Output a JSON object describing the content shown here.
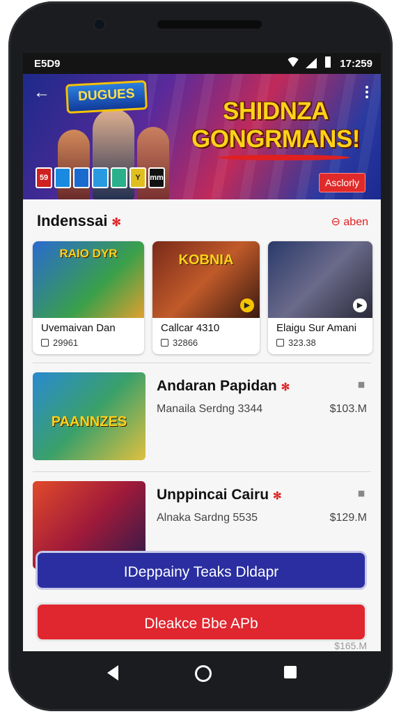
{
  "status_bar": {
    "left": "E5D9",
    "time": "17:259"
  },
  "banner": {
    "logo": "DUGUES",
    "headline_line1": "SHIDNZA",
    "headline_line2": "GONGRMANS!",
    "action_badge": "Asclorly",
    "mini_icons": [
      "59",
      "",
      "",
      "",
      "",
      "Y",
      "mm"
    ]
  },
  "section": {
    "title": "Indenssai",
    "link": "⊖ aben"
  },
  "cards": [
    {
      "thumb_text": "RAIO DYR",
      "title": "Uvemaivan Dan",
      "meta": "29961"
    },
    {
      "thumb_text": "KOBNIA",
      "title": "Callcar 4310",
      "meta": "32866"
    },
    {
      "thumb_text": "",
      "title": "Elaigu Sur Amani",
      "meta": "323.38"
    }
  ],
  "list": [
    {
      "thumb_text": "PAANNZES",
      "title": "Andaran Papidan",
      "subtitle": "Manaila Serdng 3344",
      "price": "$103.M"
    },
    {
      "thumb_text": "",
      "title": "Unppincai Cairu",
      "subtitle": "Alnaka Sardng 5535",
      "price": "$129.M"
    }
  ],
  "buttons": {
    "primary": "IDeppainy Teaks Dldapr",
    "secondary": "Dleakce Bbe APb"
  },
  "peek_price": "$165.M",
  "colors": {
    "accent_red": "#e0262e",
    "primary_blue": "#2a2ea0",
    "headline_yellow": "#ffd21a"
  }
}
